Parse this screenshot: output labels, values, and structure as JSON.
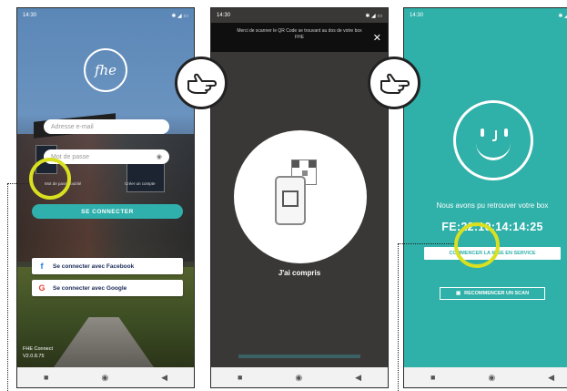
{
  "status": {
    "time": "14:30"
  },
  "screen1": {
    "logo": "fhe",
    "email_placeholder": "Adresse e-mail",
    "password_placeholder": "Mot de passe",
    "forgot_link": "Mot de passe oublié",
    "other_link": "Créer un compte",
    "connect_button": "SE CONNECTER",
    "facebook_button": "Se connecter avec Facebook",
    "google_button": "Se connecter avec Google",
    "app_name": "FHE Connect",
    "version": "V2.0.8.75"
  },
  "screen2": {
    "banner": "Merci de scanner le QR Code se trouvant au dos de votre box FHE",
    "close": "✕",
    "ok_label": "J'ai compris"
  },
  "screen3": {
    "found_text": "Nous avons pu retrouver votre box",
    "mac_address": "FE:22:10:14:14:25",
    "primary_button": "COMMENCER LA MISE EN SERVICE",
    "secondary_button": "RECOMMENCER UN SCAN"
  },
  "nav": {
    "square": "■",
    "circle": "◉",
    "back": "◀"
  },
  "colors": {
    "teal": "#2fb0a9",
    "highlight": "#d8e020",
    "facebook": "#1877f2"
  }
}
